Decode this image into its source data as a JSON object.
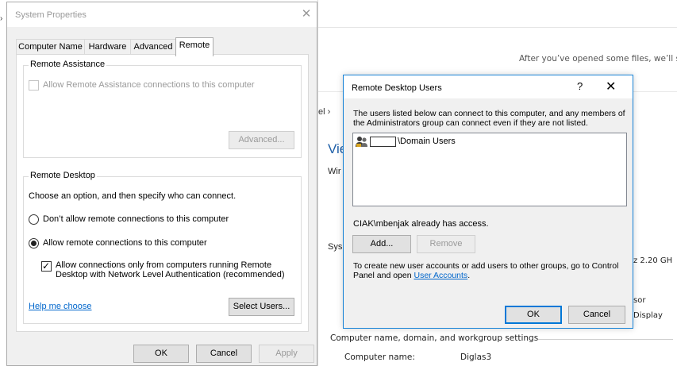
{
  "system_properties": {
    "title": "System Properties",
    "tabs": [
      "Computer Name",
      "Hardware",
      "Advanced",
      "Remote"
    ],
    "active_tab": "Remote",
    "remote_assistance": {
      "group_label": "Remote Assistance",
      "allow_label": "Allow Remote Assistance connections to this computer",
      "allow_checked": false,
      "advanced_button": "Advanced..."
    },
    "remote_desktop": {
      "group_label": "Remote Desktop",
      "instruction": "Choose an option, and then specify who can connect.",
      "option_dont_allow": "Don’t allow remote connections to this computer",
      "option_allow": "Allow remote connections to this computer",
      "selected_option": "allow",
      "nla_label_line1": "Allow connections only from computers running Remote",
      "nla_label_line2": "Desktop with Network Level Authentication (recommended)",
      "nla_checked": true,
      "help_link": "Help me choose",
      "select_users_button": "Select Users..."
    },
    "buttons": {
      "ok": "OK",
      "cancel": "Cancel",
      "apply": "Apply"
    }
  },
  "remote_desktop_users": {
    "title": "Remote Desktop Users",
    "help_glyph": "?",
    "close_glyph": "✕",
    "description": "The users listed below can connect to this computer, and any members of the Administrators group can connect even if they are not listed.",
    "users": [
      {
        "name": "\\Domain Users"
      }
    ],
    "access_note": "CIAK\\mbenjak already has access.",
    "add_button": "Add...",
    "remove_button": "Remove",
    "footer_text": "To create new user accounts or add users to other groups, go to Control Panel and open ",
    "footer_link": "User Accounts",
    "footer_end": ".",
    "ok_button": "OK",
    "cancel_button": "Cancel"
  },
  "background_window": {
    "hint": "After you’ve opened some files, we’ll s",
    "breadcrumb": "el ›",
    "view_heading": "Vie",
    "windows_label": "Wir",
    "system_label": "Sys",
    "processor_speed": "z  2.20 GH",
    "processor_label": "sor",
    "display_label": "Display",
    "section_title": "Computer name, domain, and workgroup settings",
    "computer_name_label": "Computer name:",
    "computer_name_value": "Diglas3"
  },
  "colors": {
    "accent": "#0078d7",
    "link": "#0066cc",
    "dialog_bg": "#f0f0f0"
  }
}
